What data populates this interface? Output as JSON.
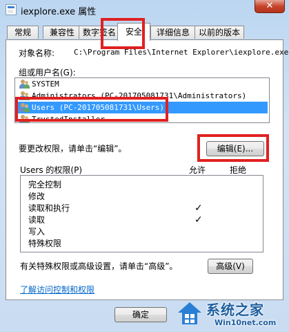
{
  "window": {
    "title": "iexplore.exe 属性",
    "close_label": "✕"
  },
  "tabs": [
    {
      "label": "常规"
    },
    {
      "label": "兼容性"
    },
    {
      "label": "数字签名"
    },
    {
      "label": "安全",
      "active": true
    },
    {
      "label": "详细信息"
    },
    {
      "label": "以前的版本"
    }
  ],
  "security": {
    "object_name_label": "对象名称:",
    "object_name_value": "C:\\Program Files\\Internet Explorer\\iexplore.exe",
    "groups_label": "组或用户名(G):",
    "users": [
      {
        "name": "SYSTEM"
      },
      {
        "name": "Administrators (PC-201705081731\\Administrators)"
      },
      {
        "name": "Users (PC-201705081731\\Users)",
        "selected": true
      },
      {
        "name": "TrustedInstaller"
      }
    ],
    "change_perm_text": "要更改权限，请单击“编辑”。",
    "edit_button": "编辑(E)...",
    "perm_label": "Users 的权限(P)",
    "allow_header": "允许",
    "deny_header": "拒绝",
    "permissions": [
      {
        "name": "完全控制",
        "allow": false,
        "deny": false
      },
      {
        "name": "修改",
        "allow": false,
        "deny": false
      },
      {
        "name": "读取和执行",
        "allow": true,
        "deny": false
      },
      {
        "name": "读取",
        "allow": true,
        "deny": false
      },
      {
        "name": "写入",
        "allow": false,
        "deny": false
      },
      {
        "name": "特殊权限",
        "allow": false,
        "deny": false
      }
    ],
    "check_glyph": "✓",
    "advanced_text": "有关特殊权限或高级设置，请单击“高级”。",
    "advanced_button": "高级(V)",
    "learn_link": "了解访问控制和权限"
  },
  "footer": {
    "ok_button": "确定"
  },
  "watermark": {
    "line1": "系统之家",
    "line2": "Win10net.com"
  },
  "colors": {
    "selection": "#3399ff",
    "highlight_box": "#e02020",
    "link": "#0066cc"
  }
}
